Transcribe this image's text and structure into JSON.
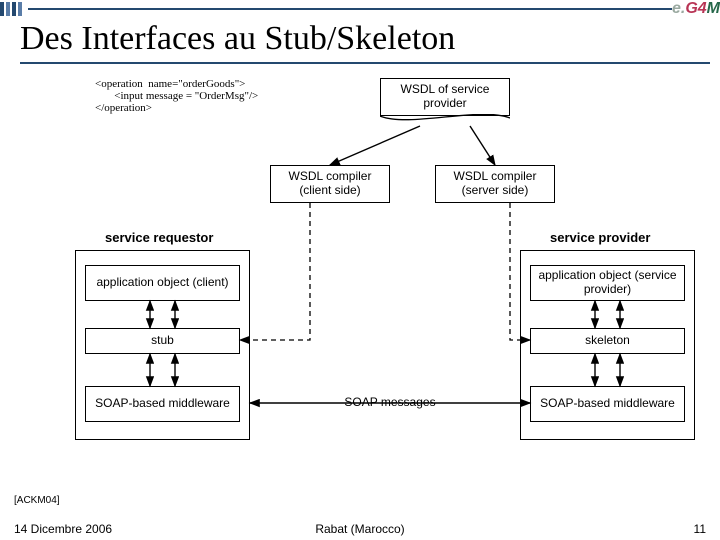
{
  "header": {
    "logo_e": "e.",
    "logo_g": "G4",
    "logo_m": "M",
    "title": "Des Interfaces au Stub/Skeleton"
  },
  "code": "<operation  name=\"orderGoods\">\n       <input message = \"OrderMsg\"/>\n</operation>",
  "boxes": {
    "wsdl_provider": "WSDL of service\nprovider",
    "wsdl_compiler_client": "WSDL compiler\n(client side)",
    "wsdl_compiler_server": "WSDL compiler\n(server side)",
    "service_requestor": "service requestor",
    "service_provider": "service provider",
    "app_client": "application object\n(client)",
    "app_server": "application object\n(service provider)",
    "stub": "stub",
    "skeleton": "skeleton",
    "soap_mw_left": "SOAP-based\nmiddleware",
    "soap_mw_right": "SOAP-based\nmiddleware",
    "soap_messages": "SOAP messages"
  },
  "footer": {
    "citation": "[ACKM04]",
    "date": "14 Dicembre 2006",
    "location": "Rabat (Marocco)",
    "page": "11"
  }
}
